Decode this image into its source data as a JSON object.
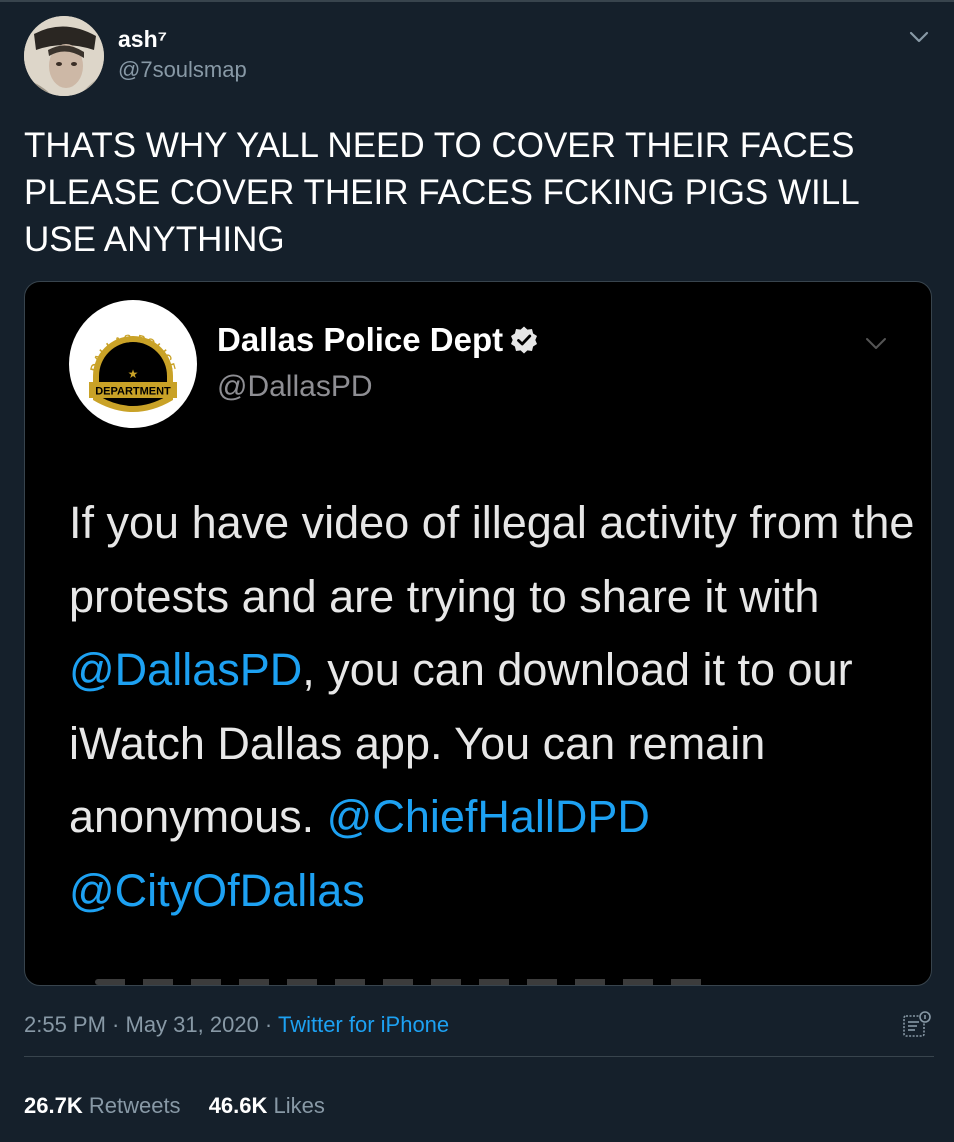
{
  "author": {
    "display_name": "ash⁷",
    "handle": "@7soulsmap",
    "avatar_icon": "user-avatar-photo"
  },
  "tweet": {
    "text": "THATS WHY YALL NEED TO COVER THEIR FACES PLEASE COVER THEIR FACES FCKING PIGS WILL USE ANYTHING"
  },
  "embedded": {
    "display_name": "Dallas Police Dept",
    "handle": "@DallasPD",
    "verified_icon": "verified-badge-icon",
    "logo_top_text": "DALLAS POLICE",
    "logo_banner_text": "DEPARTMENT",
    "text_part1": "If you have video of illegal activity from the protests and are trying to share it with ",
    "mention1": "@DallasPD",
    "text_part2": ", you can download it to our iWatch Dallas app. You can remain anonymous. ",
    "mention2": "@ChiefHallDPD",
    "text_space": " ",
    "mention3": "@CityOfDallas"
  },
  "meta": {
    "time": "2:55 PM",
    "sep1": " · ",
    "date": "May 31, 2020",
    "sep2": " · ",
    "source": "Twitter for iPhone"
  },
  "stats": {
    "retweets_count": "26.7K",
    "retweets_label": "Retweets",
    "likes_count": "46.6K",
    "likes_label": "Likes"
  },
  "colors": {
    "background": "#15202b",
    "accent": "#1da1f2",
    "secondary_text": "#8899a6",
    "embed_background": "#000000"
  }
}
